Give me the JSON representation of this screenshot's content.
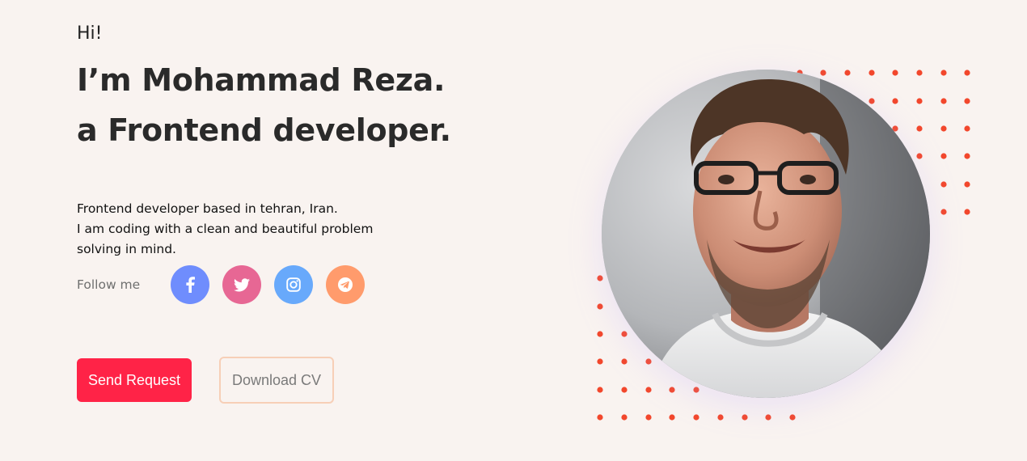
{
  "hero": {
    "greeting": "Hi!",
    "headline_line1": "I’m Mohammad Reza.",
    "headline_line2": "a Frontend developer.",
    "description_line1": "Frontend developer based in tehran, Iran.",
    "description_line2": "I am coding with a clean and beautiful problem",
    "description_line3": "solving in mind."
  },
  "social": {
    "follow_label": "Follow me",
    "links": [
      {
        "name": "facebook",
        "icon": "facebook-icon",
        "color": "#6f8dfd"
      },
      {
        "name": "twitter",
        "icon": "twitter-icon",
        "color": "#e76794"
      },
      {
        "name": "instagram",
        "icon": "instagram-icon",
        "color": "#68a9fb"
      },
      {
        "name": "telegram",
        "icon": "telegram-icon",
        "color": "#ff9b6c"
      }
    ]
  },
  "actions": {
    "send_request_label": "Send Request",
    "download_cv_label": "Download CV"
  },
  "colors": {
    "background": "#f9f3f0",
    "accent": "#ff2347",
    "dot": "#f2472c",
    "outline": "#f7cfb7"
  },
  "portrait": {
    "icon": "portrait-photo"
  }
}
